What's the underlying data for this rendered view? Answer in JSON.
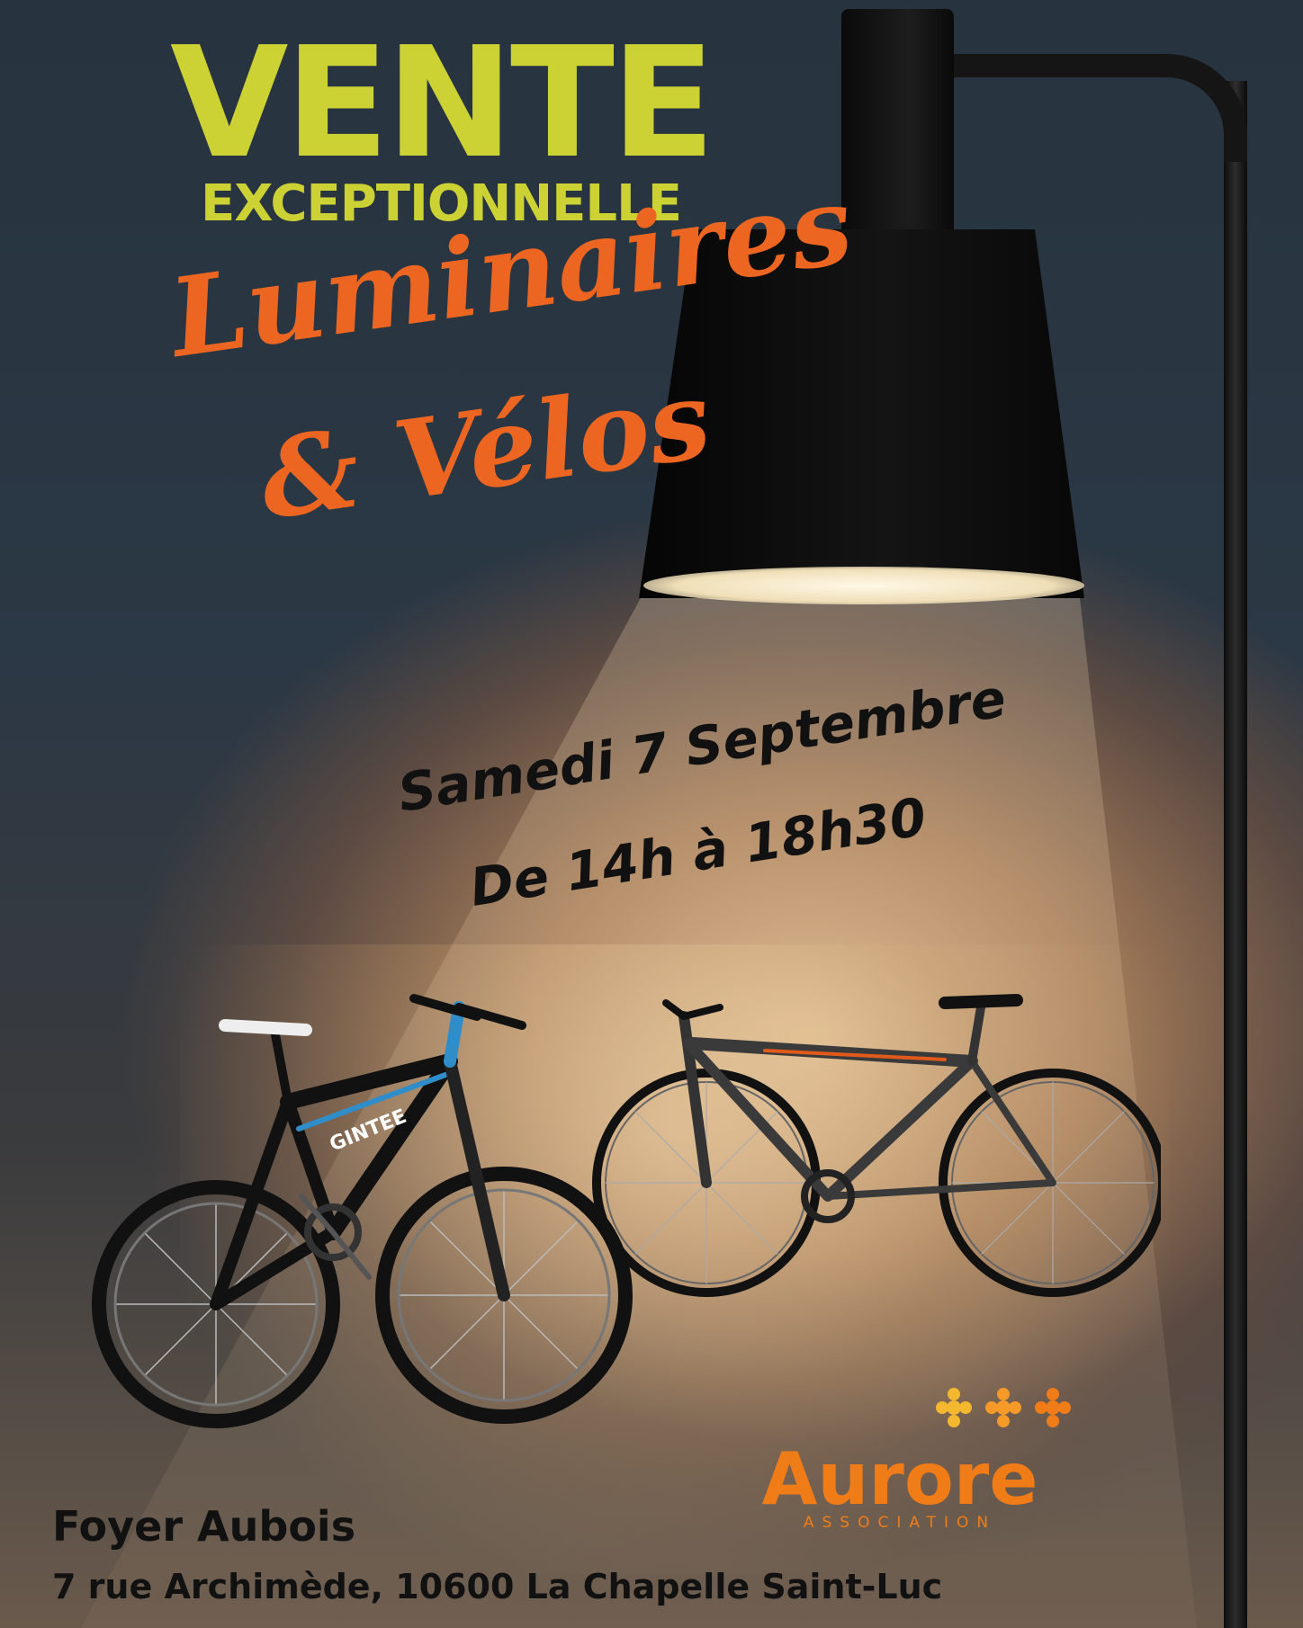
{
  "title": {
    "main": "VENTE",
    "sub": "EXCEPTIONNELLE",
    "color": "#ccd233"
  },
  "headline": {
    "line1": "Luminaires",
    "line2": "& Vélos",
    "color": "#ec6622"
  },
  "schedule": {
    "date": "Samedi 7 Septembre",
    "hours": "De 14h à 18h30"
  },
  "venue": {
    "name": "Foyer Aubois",
    "address": "7 rue Archimède, 10600 La Chapelle Saint-Luc"
  },
  "logo": {
    "name": "Aurore",
    "subtitle": "ASSOCIATION",
    "color": "#f07c18",
    "icon": "three-stars-icon"
  },
  "bikes": {
    "left": {
      "brand_text": "GINTEE",
      "colors": [
        "#111111",
        "#2f8ec9"
      ],
      "icon": "mountain-bike-icon"
    },
    "right": {
      "colors": [
        "#3a3a3a",
        "#e05a1c"
      ],
      "icon": "hybrid-bike-icon"
    }
  },
  "scene": {
    "icon": "desk-lamp-icon",
    "lamp_color": "#111111",
    "background_color": "#27343f"
  }
}
